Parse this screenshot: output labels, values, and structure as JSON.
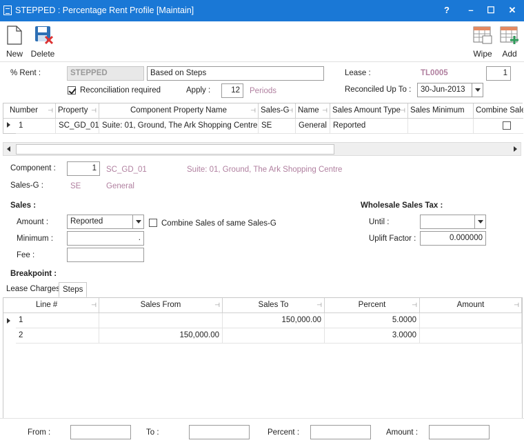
{
  "window": {
    "title": "STEPPED : Percentage Rent Profile [Maintain]",
    "help": "?",
    "minimize": "–",
    "maximize": "☐",
    "close": "✕"
  },
  "toolbar": {
    "new": "New",
    "delete": "Delete",
    "wipe": "Wipe",
    "add": "Add"
  },
  "header": {
    "rent_label": "% Rent :",
    "rent_code": "STEPPED",
    "rent_desc": "Based on Steps",
    "reconciliation_label": "Reconciliation required",
    "reconciliation_checked": true,
    "apply_label": "Apply :",
    "apply_value": "12",
    "periods_label": "Periods",
    "lease_label": "Lease :",
    "lease_value": "TL0005",
    "lease_num": "1",
    "reconciled_label": "Reconciled Up To :",
    "reconciled_value": "30-Jun-2013"
  },
  "top_grid": {
    "headers": [
      "Number",
      "Property",
      "Component Property Name",
      "Sales-G",
      "Name",
      "Sales Amount Type",
      "Sales Minimum",
      "Combine Sale"
    ],
    "rows": [
      {
        "number": "1",
        "property": "SC_GD_01",
        "component": "Suite: 01, Ground, The Ark Shopping Centre",
        "sales_g": "SE",
        "name": "General",
        "amount_type": "Reported",
        "minimum": "",
        "combine": false
      }
    ]
  },
  "component": {
    "label": "Component :",
    "number": "1",
    "property": "SC_GD_01",
    "name": "Suite: 01, Ground, The Ark Shopping Centre",
    "salesg_label": "Sales-G :",
    "salesg_code": "SE",
    "salesg_name": "General"
  },
  "sales": {
    "heading": "Sales :",
    "amount_label": "Amount :",
    "amount_value": "Reported",
    "combine_label": "Combine Sales of same Sales-G",
    "minimum_label": "Minimum :",
    "minimum_value": ".",
    "fee_label": "Fee :",
    "fee_value": ""
  },
  "wst": {
    "heading": "Wholesale Sales Tax :",
    "until_label": "Until :",
    "until_value": "",
    "uplift_label": "Uplift Factor :",
    "uplift_value": "0.000000"
  },
  "breakpoint": {
    "heading": "Breakpoint :"
  },
  "tabs": [
    "Lease Charges",
    "Steps"
  ],
  "steps_grid": {
    "headers": [
      "Line #",
      "Sales From",
      "Sales To",
      "Percent",
      "Amount"
    ],
    "rows": [
      {
        "line": "1",
        "from": "",
        "to": "150,000.00",
        "percent": "5.0000",
        "amount": ""
      },
      {
        "line": "2",
        "from": "150,000.00",
        "to": "",
        "percent": "3.0000",
        "amount": ""
      }
    ]
  },
  "footer": {
    "from_label": "From :",
    "to_label": "To :",
    "percent_label": "Percent :",
    "amount_label": "Amount :"
  }
}
